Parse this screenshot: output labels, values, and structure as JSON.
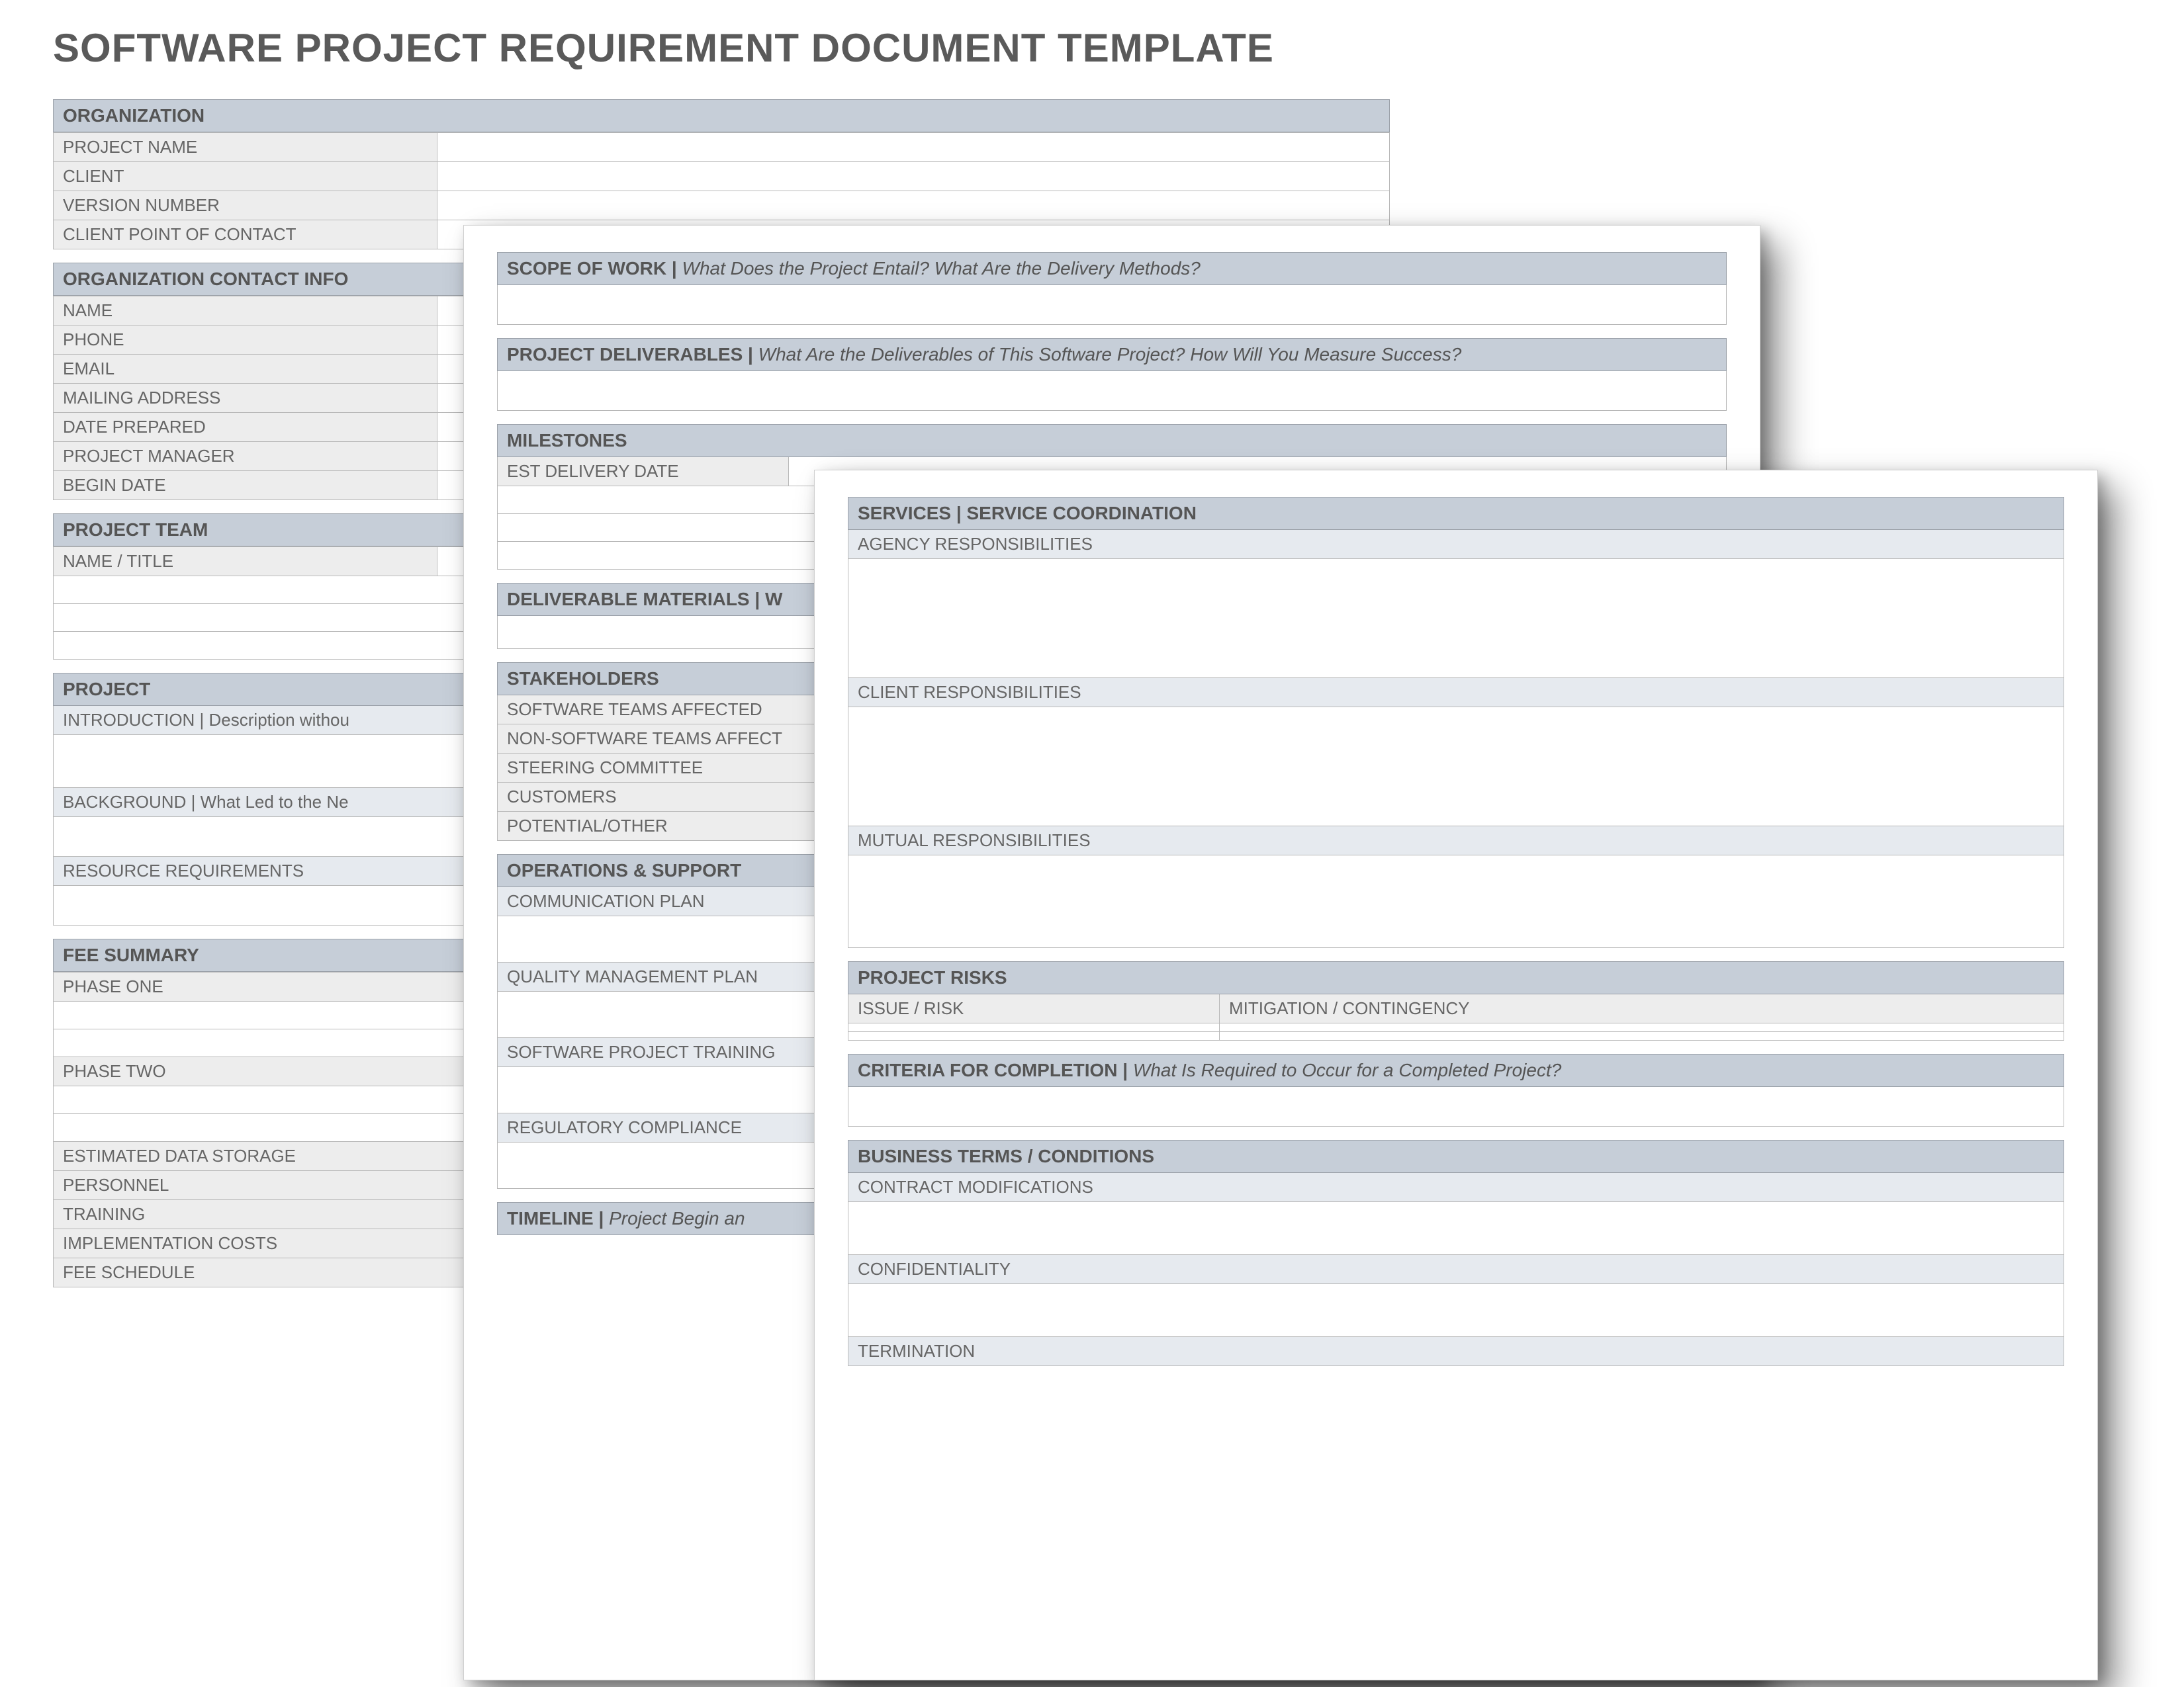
{
  "doc_title": "SOFTWARE PROJECT REQUIREMENT DOCUMENT TEMPLATE",
  "page1": {
    "organization": {
      "header": "ORGANIZATION",
      "rows": [
        "PROJECT NAME",
        "CLIENT",
        "VERSION NUMBER",
        "CLIENT POINT OF CONTACT"
      ]
    },
    "org_contact": {
      "header": "ORGANIZATION CONTACT INFO",
      "rows": [
        "NAME",
        "PHONE",
        "EMAIL",
        "MAILING ADDRESS",
        "DATE PREPARED",
        "PROJECT MANAGER",
        "BEGIN DATE"
      ]
    },
    "project_team": {
      "header": "PROJECT TEAM",
      "cols": [
        "NAME / TITLE"
      ]
    },
    "project": {
      "header": "PROJECT",
      "intro_label": "INTRODUCTION  |  ",
      "intro_hint": "Description withou",
      "background_label": "BACKGROUND  |  ",
      "background_hint": "What Led to the Ne",
      "resource_req": "RESOURCE REQUIREMENTS"
    },
    "fee": {
      "header": "FEE SUMMARY",
      "phase_one": "PHASE ONE",
      "phase_two": "PHASE TWO",
      "rows": [
        "ESTIMATED DATA STORAGE",
        "PERSONNEL",
        "TRAINING",
        "IMPLEMENTATION COSTS",
        "FEE SCHEDULE"
      ]
    }
  },
  "page2": {
    "scope": {
      "header": "SCOPE OF WORK  |  ",
      "hint": "What Does the Project Entail? What Are the Delivery Methods?"
    },
    "deliverables": {
      "header": "PROJECT DELIVERABLES  |  ",
      "hint": "What Are the Deliverables of This Software Project? How Will You Measure Success?"
    },
    "milestones": {
      "header": "MILESTONES",
      "row": "EST DELIVERY DATE"
    },
    "deliverable_materials": {
      "header": "DELIVERABLE MATERIALS  |  W"
    },
    "stakeholders": {
      "header": "STAKEHOLDERS",
      "rows": [
        "SOFTWARE TEAMS AFFECTED",
        "NON-SOFTWARE TEAMS AFFECT",
        "STEERING COMMITTEE",
        "CUSTOMERS",
        "POTENTIAL/OTHER"
      ]
    },
    "ops": {
      "header": "OPERATIONS & SUPPORT",
      "rows": [
        "COMMUNICATION PLAN",
        "QUALITY MANAGEMENT PLAN",
        "SOFTWARE PROJECT TRAINING",
        "REGULATORY COMPLIANCE"
      ]
    },
    "timeline": {
      "header": "TIMELINE  |  ",
      "hint": "Project Begin an"
    }
  },
  "page3": {
    "services": {
      "header": "SERVICES | SERVICE COORDINATION",
      "rows": [
        "AGENCY RESPONSIBILITIES",
        "CLIENT RESPONSIBILITIES",
        "MUTUAL RESPONSIBILITIES"
      ]
    },
    "risks": {
      "header": "PROJECT RISKS",
      "col1": "ISSUE / RISK",
      "col2": "MITIGATION / CONTINGENCY"
    },
    "criteria": {
      "header": "CRITERIA FOR COMPLETION  |  ",
      "hint": "What Is Required to Occur for a Completed Project?"
    },
    "terms": {
      "header": "BUSINESS TERMS / CONDITIONS",
      "rows": [
        "CONTRACT MODIFICATIONS",
        "CONFIDENTIALITY",
        "TERMINATION"
      ]
    }
  }
}
